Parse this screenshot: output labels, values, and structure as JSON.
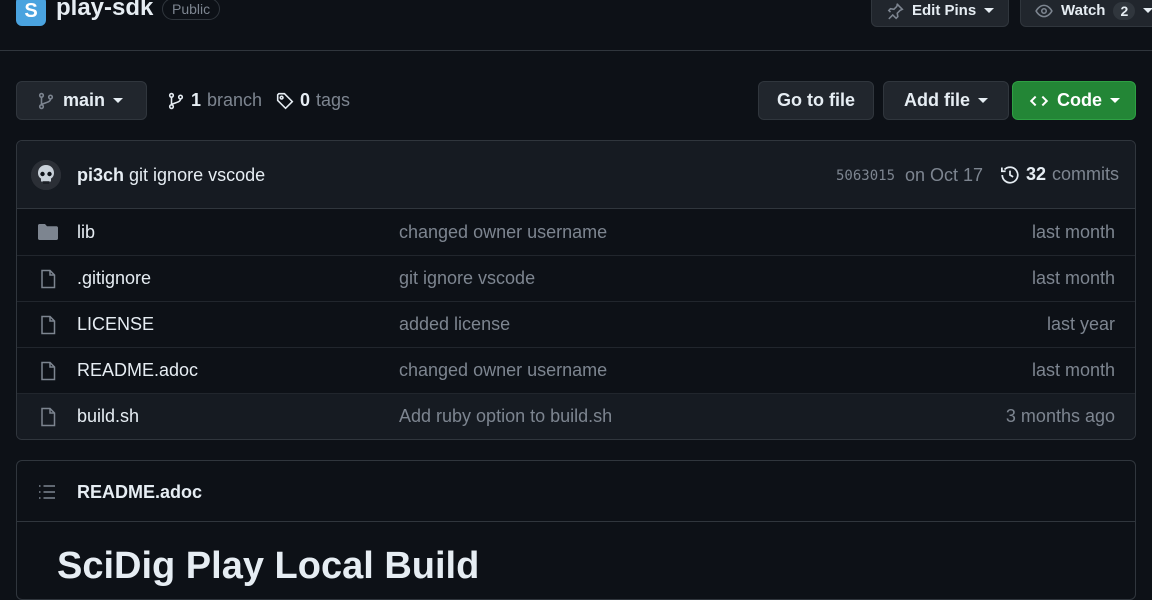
{
  "header": {
    "avatar_letter": "S",
    "repo_name": "play-sdk",
    "visibility": "Public",
    "edit_pins_label": "Edit Pins",
    "watch_label": "Watch",
    "watch_count": "2"
  },
  "toolbar": {
    "branch_name": "main",
    "branch_count": "1",
    "branch_label": "branch",
    "tag_count": "0",
    "tag_label": "tags",
    "go_to_file_label": "Go to file",
    "add_file_label": "Add file",
    "code_label": "Code"
  },
  "commit": {
    "author": "pi3ch",
    "message": "git ignore vscode",
    "hash": "5063015",
    "date": "on Oct 17",
    "commit_count": "32",
    "commits_label": "commits"
  },
  "files": [
    {
      "name": "lib",
      "type": "folder",
      "message": "changed owner username",
      "time": "last month"
    },
    {
      "name": ".gitignore",
      "type": "file",
      "message": "git ignore vscode",
      "time": "last month"
    },
    {
      "name": "LICENSE",
      "type": "file",
      "message": "added license",
      "time": "last year"
    },
    {
      "name": "README.adoc",
      "type": "file",
      "message": "changed owner username",
      "time": "last month"
    },
    {
      "name": "build.sh",
      "type": "file",
      "message": "Add ruby option to build.sh",
      "time": "3 months ago"
    }
  ],
  "readme": {
    "filename": "README.adoc",
    "heading": "SciDig Play Local Build"
  },
  "colors": {
    "background": "#0d1117",
    "code_button": "#238636",
    "muted_text": "#7d8590",
    "border": "#30363d"
  }
}
